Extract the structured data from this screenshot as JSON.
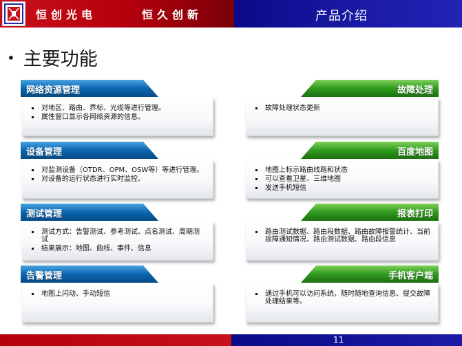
{
  "header": {
    "company": "恒创光电",
    "slogan": "恒久创新",
    "title": "产品介绍"
  },
  "main_title": "主要功能",
  "bullet_symbol": "•",
  "colors": {
    "header_red": "#c8101a",
    "header_blue": "#1b1ba8",
    "tab_blue": "#0a5fa8",
    "tab_green": "#2f9a1e"
  },
  "sections": [
    {
      "title": "网络资源管理",
      "items": [
        "对地区、路由、界标、光缆等进行管理。",
        "属性窗口显示各网络资源的信息。"
      ]
    },
    {
      "title": "故障处理",
      "items": [
        "故障处理状态更新"
      ]
    },
    {
      "title": "设备管理",
      "items": [
        "对监测设备（OTDR、OPM、OSW等）等进行管理。",
        "对设备的运行状态进行实时监控。"
      ]
    },
    {
      "title": "百度地图",
      "items": [
        "地图上标示路由线路和状态",
        "可以查看卫星、三维地图",
        "发送手机短信"
      ]
    },
    {
      "title": "测试管理",
      "items": [
        "测试方式：告警测试、参考测试、点名测试、周期测试",
        "结果展示：地图、曲线、事件、信息"
      ]
    },
    {
      "title": "报表打印",
      "items": [
        "路由测试数据、路由段数据、路由故障报警统计、当前故障通知情况、路由测试数据、路由段信息"
      ]
    },
    {
      "title": "告警管理",
      "items": [
        "地图上闪动、手动短信"
      ]
    },
    {
      "title": "手机客户端",
      "items": [
        "通过手机可以访问系统，随时随地查询信息、提交故障处理结果等。"
      ]
    }
  ],
  "footer": {
    "page_number": "11"
  }
}
